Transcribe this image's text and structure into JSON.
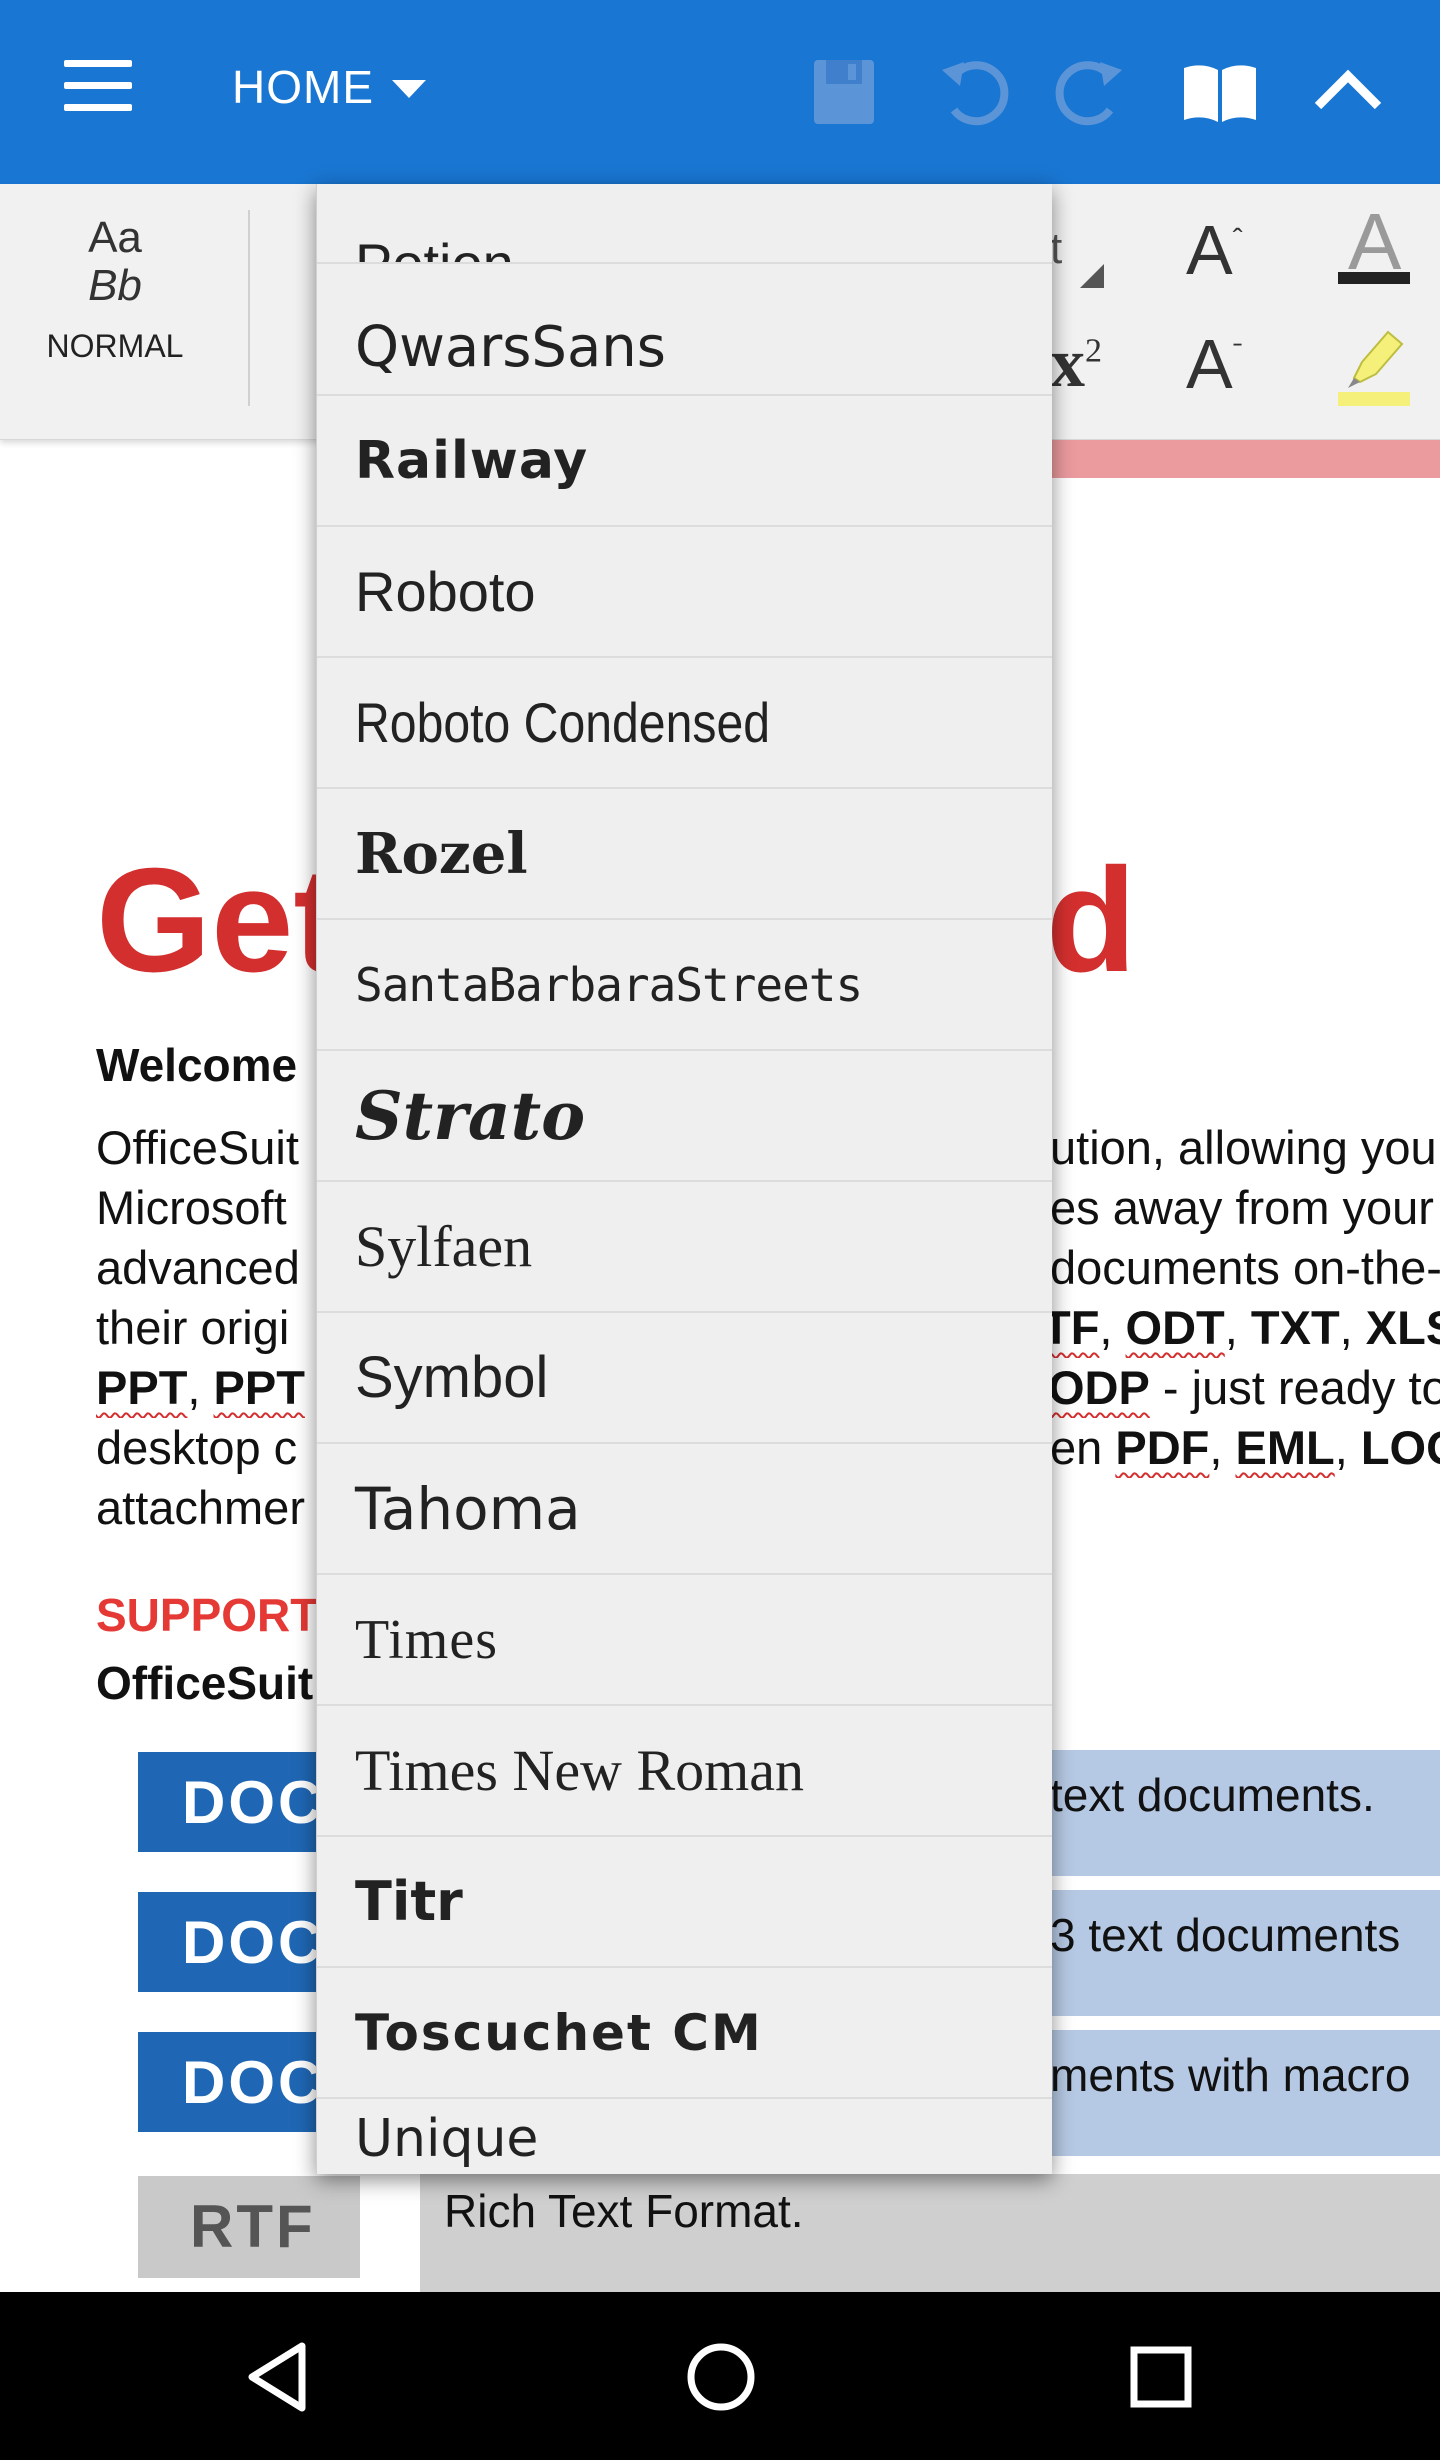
{
  "appbar": {
    "menu_icon": "hamburger-menu-icon",
    "tab_label": "HOME",
    "icons": [
      "save-icon",
      "undo-icon",
      "redo-icon",
      "read-mode-icon",
      "collapse-icon"
    ],
    "background": "#1976d2"
  },
  "ribbon": {
    "style_preview_line1": "Aa",
    "style_preview_line2": "Bb",
    "style_name": "NORMAL",
    "font_field_fragment": "t",
    "superscript_label": "x",
    "superscript_exp": "2",
    "grow_font_label": "A",
    "shrink_font_label": "A",
    "font_color_label": "A"
  },
  "document": {
    "title_left": "Get",
    "title_right": "d",
    "welcome": "Welcome",
    "para_lines": [
      {
        "left": "OfficeSuit",
        "right": "ution, allowing you"
      },
      {
        "left": "Microsoft",
        "right": "es away from your"
      },
      {
        "left": "advanced",
        "right": "documents on-the-"
      },
      {
        "left": "their origi",
        "right_parts": [
          "TF",
          ", ",
          "ODT",
          ", ",
          "TXT",
          ", ",
          "XLS"
        ]
      },
      {
        "left_parts": [
          "PPT",
          ", ",
          "PPT"
        ],
        "right_parts": [
          "ODP",
          " - just ready to"
        ]
      },
      {
        "left": "desktop c",
        "right_parts": [
          "en ",
          "PDF",
          ", ",
          "EML",
          ", ",
          "LOG"
        ]
      },
      {
        "left": "attachmer",
        "right": ""
      }
    ],
    "supported_label": "SUPPORT",
    "officesuite_label": "OfficeSuit",
    "formats": [
      {
        "badge": "DOC",
        "desc": "text documents."
      },
      {
        "badge": "DOC",
        "desc": "3 text documents"
      },
      {
        "badge": "DOC",
        "desc": "ments with macro"
      },
      {
        "badge": "RTF",
        "desc": "Rich Text Format."
      }
    ]
  },
  "font_dropdown": {
    "items": [
      "Potion",
      "QwarsSans",
      "Railway",
      "Roboto",
      "Roboto Condensed",
      "Rozel",
      "SantaBarbaraStreets",
      "Strato",
      "Sylfaen",
      "Symbol",
      "Tahoma",
      "Times",
      "Times New Roman",
      "Titr",
      "Toscuchet CM",
      "Unique"
    ]
  },
  "navbar": {
    "icons": [
      "back-icon",
      "home-icon",
      "recents-icon"
    ]
  }
}
